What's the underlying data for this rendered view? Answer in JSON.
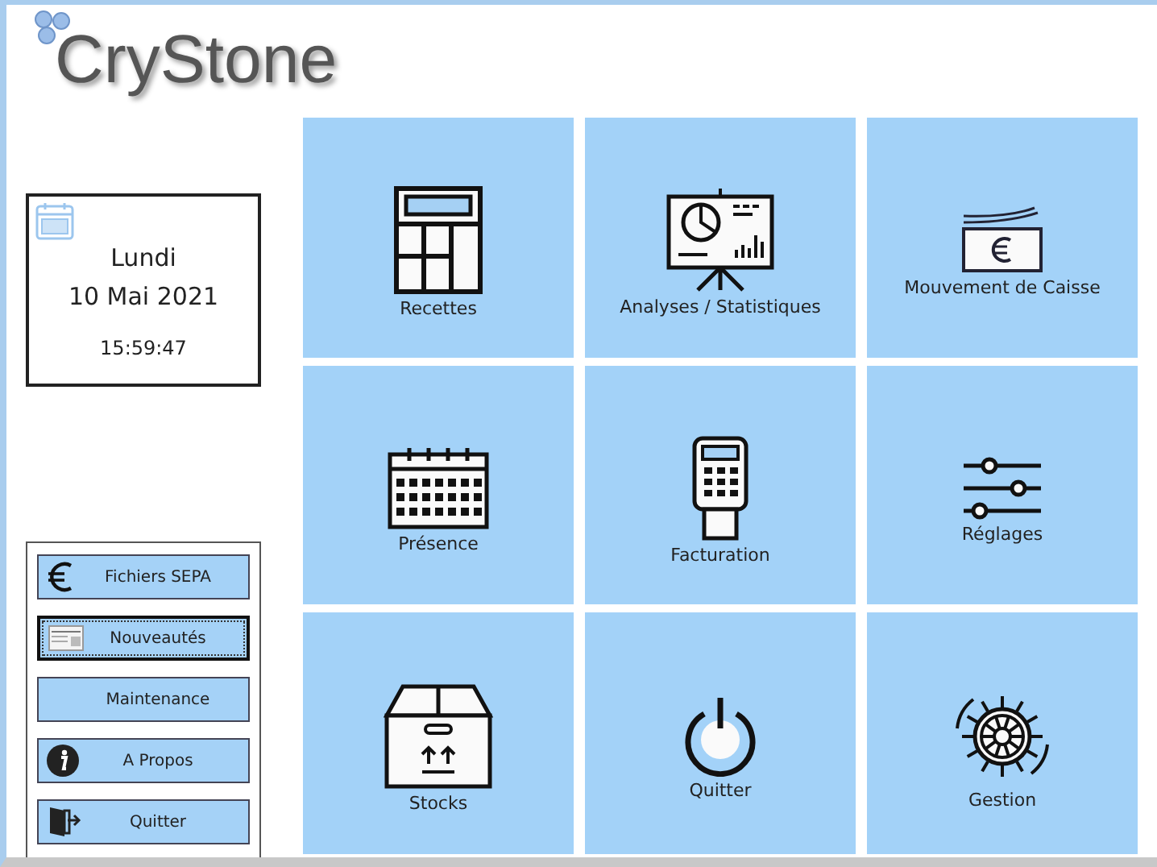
{
  "logo": {
    "text": "CryStone"
  },
  "date_card": {
    "day": "Lundi",
    "date": "10 Mai 2021",
    "time": "15:59:47"
  },
  "side_buttons": [
    {
      "label": "Fichiers SEPA",
      "kind": "euro",
      "focused": false
    },
    {
      "label": "Nouveautés",
      "kind": "news",
      "focused": true
    },
    {
      "label": "Maintenance",
      "kind": "plain",
      "focused": false
    },
    {
      "label": "A Propos",
      "kind": "info",
      "focused": false
    },
    {
      "label": "Quitter",
      "kind": "exit",
      "focused": false
    }
  ],
  "tiles": [
    {
      "label": "Recettes",
      "kind": "calculator"
    },
    {
      "label": "Analyses / Statistiques",
      "kind": "presentation"
    },
    {
      "label": "Mouvement de Caisse",
      "kind": "banknote"
    },
    {
      "label": "Présence",
      "kind": "calendar"
    },
    {
      "label": "Facturation",
      "kind": "terminal"
    },
    {
      "label": "Réglages",
      "kind": "sliders"
    },
    {
      "label": "Stocks",
      "kind": "box"
    },
    {
      "label": "Quitter",
      "kind": "power"
    },
    {
      "label": "Gestion",
      "kind": "wheel"
    }
  ]
}
